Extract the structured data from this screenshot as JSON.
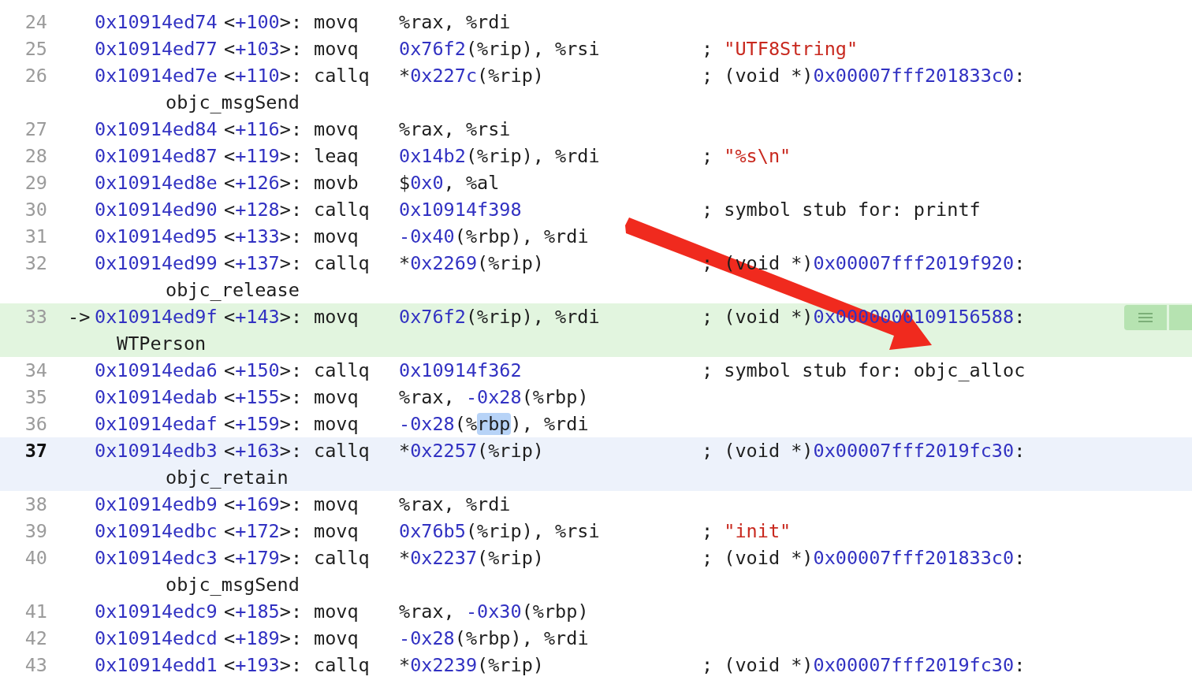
{
  "rows": [
    {
      "line": "24",
      "address": "0x10914ed74",
      "offset": [
        {
          "t": "<"
        },
        {
          "kind": "hex",
          "t": "+100"
        },
        {
          "t": ">:"
        }
      ],
      "mnemonic": "movq",
      "operands": [
        {
          "t": "%rax, %rdi"
        }
      ],
      "current": false,
      "selected": false
    },
    {
      "line": "25",
      "address": "0x10914ed77",
      "offset": [
        {
          "t": "<"
        },
        {
          "kind": "hex",
          "t": "+103"
        },
        {
          "t": ">:"
        }
      ],
      "mnemonic": "movq",
      "operands": [
        {
          "kind": "hex",
          "t": "0x76f2"
        },
        {
          "t": "(%rip), %rsi"
        }
      ],
      "comment": [
        {
          "t": "; "
        },
        {
          "kind": "str",
          "t": "\"UTF8String\""
        }
      ],
      "current": false,
      "selected": false
    },
    {
      "line": "26",
      "address": "0x10914ed7e",
      "offset": [
        {
          "t": "<"
        },
        {
          "kind": "hex",
          "t": "+110"
        },
        {
          "t": ">:"
        }
      ],
      "mnemonic": "callq",
      "operands": [
        {
          "t": "*"
        },
        {
          "kind": "hex",
          "t": "0x227c"
        },
        {
          "t": "(%rip)"
        }
      ],
      "comment": [
        {
          "t": "; (void *)"
        },
        {
          "kind": "hex",
          "t": "0x00007fff201833c0"
        },
        {
          "t": ":"
        }
      ],
      "wrap": "objc_msgSend",
      "current": false,
      "selected": false
    },
    {
      "line": "27",
      "address": "0x10914ed84",
      "offset": [
        {
          "t": "<"
        },
        {
          "kind": "hex",
          "t": "+116"
        },
        {
          "t": ">:"
        }
      ],
      "mnemonic": "movq",
      "operands": [
        {
          "t": "%rax, %rsi"
        }
      ],
      "current": false,
      "selected": false
    },
    {
      "line": "28",
      "address": "0x10914ed87",
      "offset": [
        {
          "t": "<"
        },
        {
          "kind": "hex",
          "t": "+119"
        },
        {
          "t": ">:"
        }
      ],
      "mnemonic": "leaq",
      "operands": [
        {
          "kind": "hex",
          "t": "0x14b2"
        },
        {
          "t": "(%rip), %rdi"
        }
      ],
      "comment": [
        {
          "t": "; "
        },
        {
          "kind": "str",
          "t": "\"%s\\n\""
        }
      ],
      "current": false,
      "selected": false
    },
    {
      "line": "29",
      "address": "0x10914ed8e",
      "offset": [
        {
          "t": "<"
        },
        {
          "kind": "hex",
          "t": "+126"
        },
        {
          "t": ">:"
        }
      ],
      "mnemonic": "movb",
      "operands": [
        {
          "t": "$"
        },
        {
          "kind": "hex",
          "t": "0x0"
        },
        {
          "t": ", %al"
        }
      ],
      "current": false,
      "selected": false
    },
    {
      "line": "30",
      "address": "0x10914ed90",
      "offset": [
        {
          "t": "<"
        },
        {
          "kind": "hex",
          "t": "+128"
        },
        {
          "t": ">:"
        }
      ],
      "mnemonic": "callq",
      "operands": [
        {
          "kind": "hex",
          "t": "0x10914f398"
        }
      ],
      "comment": [
        {
          "t": "; symbol stub for: printf"
        }
      ],
      "current": false,
      "selected": false
    },
    {
      "line": "31",
      "address": "0x10914ed95",
      "offset": [
        {
          "t": "<"
        },
        {
          "kind": "hex",
          "t": "+133"
        },
        {
          "t": ">:"
        }
      ],
      "mnemonic": "movq",
      "operands": [
        {
          "kind": "hex",
          "t": "-0x40"
        },
        {
          "t": "(%rbp), %rdi"
        }
      ],
      "current": false,
      "selected": false
    },
    {
      "line": "32",
      "address": "0x10914ed99",
      "offset": [
        {
          "t": "<"
        },
        {
          "kind": "hex",
          "t": "+137"
        },
        {
          "t": ">:"
        }
      ],
      "mnemonic": "callq",
      "operands": [
        {
          "t": "*"
        },
        {
          "kind": "hex",
          "t": "0x2269"
        },
        {
          "t": "(%rip)"
        }
      ],
      "comment": [
        {
          "t": "; (void *)"
        },
        {
          "kind": "hex",
          "t": "0x00007fff2019f920"
        },
        {
          "t": ":"
        }
      ],
      "wrap": "objc_release",
      "current": false,
      "selected": false
    },
    {
      "line": "33",
      "marker": "->",
      "address": "0x10914ed9f",
      "offset": [
        {
          "t": "<"
        },
        {
          "kind": "hex",
          "t": "+143"
        },
        {
          "t": ">:"
        }
      ],
      "mnemonic": "movq",
      "operands": [
        {
          "kind": "hex",
          "t": "0x76f2"
        },
        {
          "t": "(%rip), %rdi"
        }
      ],
      "comment": [
        {
          "t": "; (void *)"
        },
        {
          "kind": "hex",
          "t": "0x0000000109156588"
        },
        {
          "t": ":"
        }
      ],
      "wrap": "WTPerson",
      "current": true,
      "selected": false
    },
    {
      "line": "34",
      "address": "0x10914eda6",
      "offset": [
        {
          "t": "<"
        },
        {
          "kind": "hex",
          "t": "+150"
        },
        {
          "t": ">:"
        }
      ],
      "mnemonic": "callq",
      "operands": [
        {
          "kind": "hex",
          "t": "0x10914f362"
        }
      ],
      "comment": [
        {
          "t": "; symbol stub for: objc_alloc"
        }
      ],
      "current": false,
      "selected": false
    },
    {
      "line": "35",
      "address": "0x10914edab",
      "offset": [
        {
          "t": "<"
        },
        {
          "kind": "hex",
          "t": "+155"
        },
        {
          "t": ">:"
        }
      ],
      "mnemonic": "movq",
      "operands": [
        {
          "t": "%rax, "
        },
        {
          "kind": "hex",
          "t": "-0x28"
        },
        {
          "t": "(%rbp)"
        }
      ],
      "current": false,
      "selected": false
    },
    {
      "line": "36",
      "address": "0x10914edaf",
      "offset": [
        {
          "t": "<"
        },
        {
          "kind": "hex",
          "t": "+159"
        },
        {
          "t": ">:"
        }
      ],
      "mnemonic": "movq",
      "operands": [
        {
          "kind": "hex",
          "t": "-0x28"
        },
        {
          "t": "(%"
        },
        {
          "kind": "match",
          "t": "rbp"
        },
        {
          "t": "), %rdi"
        }
      ],
      "current": false,
      "selected": false
    },
    {
      "line": "37",
      "address": "0x10914edb3",
      "offset": [
        {
          "t": "<"
        },
        {
          "kind": "hex",
          "t": "+163"
        },
        {
          "t": ">:"
        }
      ],
      "mnemonic": "callq",
      "operands": [
        {
          "t": "*"
        },
        {
          "kind": "hex",
          "t": "0x2257"
        },
        {
          "t": "(%rip)"
        }
      ],
      "comment": [
        {
          "t": "; (void *)"
        },
        {
          "kind": "hex",
          "t": "0x00007fff2019fc30"
        },
        {
          "t": ":"
        }
      ],
      "wrap": "objc_retain",
      "current": false,
      "selected": true
    },
    {
      "line": "38",
      "address": "0x10914edb9",
      "offset": [
        {
          "t": "<"
        },
        {
          "kind": "hex",
          "t": "+169"
        },
        {
          "t": ">:"
        }
      ],
      "mnemonic": "movq",
      "operands": [
        {
          "t": "%rax, %rdi"
        }
      ],
      "current": false,
      "selected": false
    },
    {
      "line": "39",
      "address": "0x10914edbc",
      "offset": [
        {
          "t": "<"
        },
        {
          "kind": "hex",
          "t": "+172"
        },
        {
          "t": ">:"
        }
      ],
      "mnemonic": "movq",
      "operands": [
        {
          "kind": "hex",
          "t": "0x76b5"
        },
        {
          "t": "(%rip), %rsi"
        }
      ],
      "comment": [
        {
          "t": "; "
        },
        {
          "kind": "str",
          "t": "\"init\""
        }
      ],
      "current": false,
      "selected": false
    },
    {
      "line": "40",
      "address": "0x10914edc3",
      "offset": [
        {
          "t": "<"
        },
        {
          "kind": "hex",
          "t": "+179"
        },
        {
          "t": ">:"
        }
      ],
      "mnemonic": "callq",
      "operands": [
        {
          "t": "*"
        },
        {
          "kind": "hex",
          "t": "0x2237"
        },
        {
          "t": "(%rip)"
        }
      ],
      "comment": [
        {
          "t": "; (void *)"
        },
        {
          "kind": "hex",
          "t": "0x00007fff201833c0"
        },
        {
          "t": ":"
        }
      ],
      "wrap": "objc_msgSend",
      "current": false,
      "selected": false
    },
    {
      "line": "41",
      "address": "0x10914edc9",
      "offset": [
        {
          "t": "<"
        },
        {
          "kind": "hex",
          "t": "+185"
        },
        {
          "t": ">:"
        }
      ],
      "mnemonic": "movq",
      "operands": [
        {
          "t": "%rax, "
        },
        {
          "kind": "hex",
          "t": "-0x30"
        },
        {
          "t": "(%rbp)"
        }
      ],
      "current": false,
      "selected": false
    },
    {
      "line": "42",
      "address": "0x10914edcd",
      "offset": [
        {
          "t": "<"
        },
        {
          "kind": "hex",
          "t": "+189"
        },
        {
          "t": ">:"
        }
      ],
      "mnemonic": "movq",
      "operands": [
        {
          "kind": "hex",
          "t": "-0x28"
        },
        {
          "t": "(%rbp), %rdi"
        }
      ],
      "current": false,
      "selected": false
    },
    {
      "line": "43",
      "address": "0x10914edd1",
      "offset": [
        {
          "t": "<"
        },
        {
          "kind": "hex",
          "t": "+193"
        },
        {
          "t": ">:"
        }
      ],
      "mnemonic": "callq",
      "operands": [
        {
          "t": "*"
        },
        {
          "kind": "hex",
          "t": "0x2239"
        },
        {
          "t": "(%rip)"
        }
      ],
      "comment": [
        {
          "t": "; (void *)"
        },
        {
          "kind": "hex",
          "t": "0x00007fff2019fc30"
        },
        {
          "t": ":"
        }
      ],
      "current": false,
      "selected": false
    }
  ]
}
